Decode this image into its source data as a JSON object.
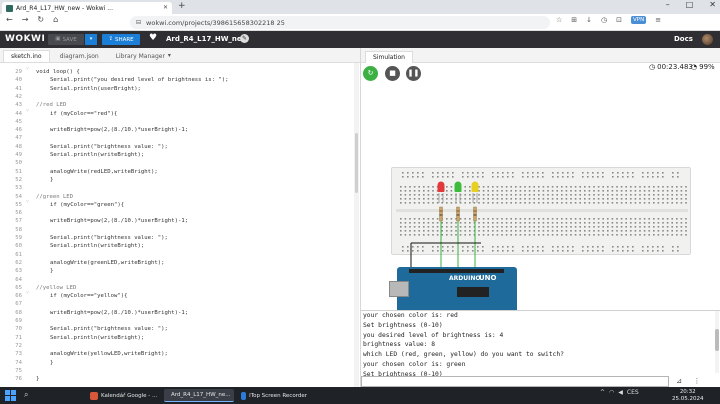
{
  "browser": {
    "tab_title": "Ard_R4_L17_HW_new - Wokwi ...",
    "url": "wokwi.com/projects/398615658302218 25",
    "vpn_label": "VPN"
  },
  "wokwi": {
    "logo": "WOKWI",
    "save_label": "SAVE",
    "share_label": "SHARE",
    "project_name": "Ard_R4_L17_HW_new",
    "docs_label": "Docs"
  },
  "editor": {
    "tabs": [
      "sketch.ino",
      "diagram.json",
      "Library Manager"
    ],
    "lines": [
      {
        "n": "29",
        "t": "void loop() {",
        "indent": 0,
        "cmt": false
      },
      {
        "n": "40",
        "t": "Serial.print(\"you desired level of brightness is: \");",
        "indent": 1,
        "cmt": false
      },
      {
        "n": "41",
        "t": "Serial.println(userBright);",
        "indent": 1,
        "cmt": false
      },
      {
        "n": "42",
        "t": "",
        "indent": 0,
        "cmt": false
      },
      {
        "n": "43",
        "t": "//red LED",
        "indent": 0,
        "cmt": true
      },
      {
        "n": "44",
        "t": "if (myColor==\"red\"){",
        "indent": 1,
        "cmt": false
      },
      {
        "n": "45",
        "t": "",
        "indent": 0,
        "cmt": false
      },
      {
        "n": "46",
        "t": "writeBright=pow(2,(8./10.)*userBright)-1;",
        "indent": 1,
        "cmt": false
      },
      {
        "n": "47",
        "t": "",
        "indent": 0,
        "cmt": false
      },
      {
        "n": "48",
        "t": "Serial.print(\"brightness value: \");",
        "indent": 1,
        "cmt": false
      },
      {
        "n": "49",
        "t": "Serial.println(writeBright);",
        "indent": 1,
        "cmt": false
      },
      {
        "n": "50",
        "t": "",
        "indent": 0,
        "cmt": false
      },
      {
        "n": "51",
        "t": "analogWrite(redLED,writeBright);",
        "indent": 1,
        "cmt": false
      },
      {
        "n": "52",
        "t": "}",
        "indent": 1,
        "cmt": false
      },
      {
        "n": "53",
        "t": "",
        "indent": 0,
        "cmt": false
      },
      {
        "n": "54",
        "t": "//green LED",
        "indent": 0,
        "cmt": true
      },
      {
        "n": "55",
        "t": "if (myColor==\"green\"){",
        "indent": 1,
        "cmt": false
      },
      {
        "n": "56",
        "t": "",
        "indent": 0,
        "cmt": false
      },
      {
        "n": "57",
        "t": "writeBright=pow(2,(8./10.)*userBright)-1;",
        "indent": 1,
        "cmt": false
      },
      {
        "n": "58",
        "t": "",
        "indent": 0,
        "cmt": false
      },
      {
        "n": "59",
        "t": "Serial.print(\"brightness value: \");",
        "indent": 1,
        "cmt": false
      },
      {
        "n": "60",
        "t": "Serial.println(writeBright);",
        "indent": 1,
        "cmt": false
      },
      {
        "n": "61",
        "t": "",
        "indent": 0,
        "cmt": false
      },
      {
        "n": "62",
        "t": "analogWrite(greenLED,writeBright);",
        "indent": 1,
        "cmt": false
      },
      {
        "n": "63",
        "t": "}",
        "indent": 1,
        "cmt": false
      },
      {
        "n": "64",
        "t": "",
        "indent": 0,
        "cmt": false
      },
      {
        "n": "65",
        "t": "//yellow LED",
        "indent": 0,
        "cmt": true
      },
      {
        "n": "66",
        "t": "if (myColor==\"yellow\"){",
        "indent": 1,
        "cmt": false
      },
      {
        "n": "67",
        "t": "",
        "indent": 0,
        "cmt": false
      },
      {
        "n": "68",
        "t": "writeBright=pow(2,(8./10.)*userBright)-1;",
        "indent": 1,
        "cmt": false
      },
      {
        "n": "69",
        "t": "",
        "indent": 0,
        "cmt": false
      },
      {
        "n": "70",
        "t": "Serial.print(\"brightness value: \");",
        "indent": 1,
        "cmt": false
      },
      {
        "n": "71",
        "t": "Serial.println(writeBright);",
        "indent": 1,
        "cmt": false
      },
      {
        "n": "72",
        "t": "",
        "indent": 0,
        "cmt": false
      },
      {
        "n": "73",
        "t": "analogWrite(yellowLED,writeBright);",
        "indent": 1,
        "cmt": false
      },
      {
        "n": "74",
        "t": "}",
        "indent": 1,
        "cmt": false
      },
      {
        "n": "75",
        "t": "",
        "indent": 0,
        "cmt": false
      },
      {
        "n": "76",
        "t": "}",
        "indent": 0,
        "cmt": false
      }
    ]
  },
  "simulation": {
    "tab_label": "Simulation",
    "time": "00:23.483",
    "speed": "99%",
    "board_brand": "ARDUINO",
    "board_model": "UNO",
    "leds": [
      {
        "color": "red",
        "hex": "#e23a3a"
      },
      {
        "color": "green",
        "hex": "#3dbb3d"
      },
      {
        "color": "yellow",
        "hex": "#e8d020"
      }
    ]
  },
  "serial_monitor": {
    "lines": [
      "your chosen color is: red",
      "Set brightness (0-10)",
      "you desired level of brightness is: 4",
      "brightness value: 8",
      "which LED (red, green, yellow) do you want to switch?",
      "your chosen color is: green",
      "Set brightness (0-10)"
    ]
  },
  "taskbar": {
    "apps": [
      {
        "label": "Kalendář Google - ...",
        "color": "#d8583b"
      },
      {
        "label": "Ard_R4_L17_HW_ne...",
        "color": "#d8583b"
      },
      {
        "label": "iTop Screen Recorder",
        "color": "#2b7bd8"
      }
    ],
    "lang": "CES",
    "time": "20:32",
    "date": "25.05.2024"
  },
  "colors": {
    "wokwi_bar": "#2e2e33",
    "accent_blue": "#1b7fd8",
    "arduino_blue": "#1e6a9b",
    "restart_green": "#3cb043"
  }
}
